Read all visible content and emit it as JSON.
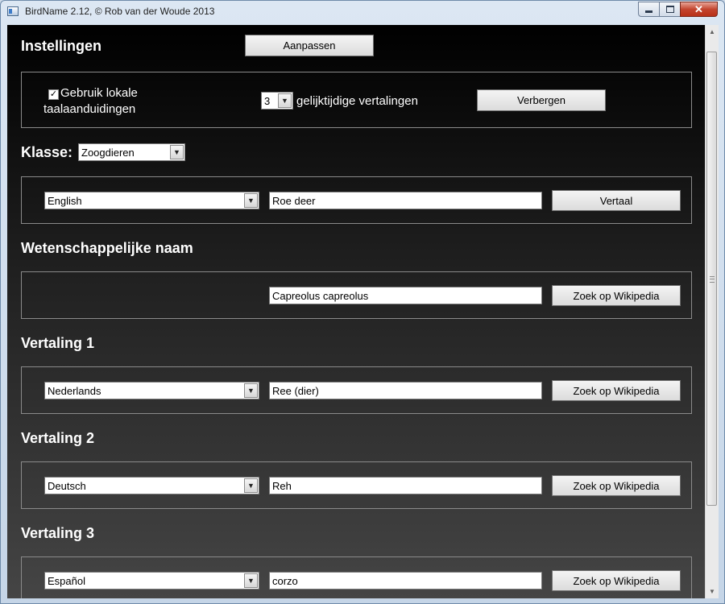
{
  "window": {
    "title": "BirdName 2.12, © Rob van der Woude 2013",
    "close_glyph": "✕"
  },
  "settings": {
    "heading": "Instellingen",
    "customize_label": "Aanpassen",
    "use_local_label_line1": "Gebruik lokale",
    "use_local_label_line2": "taalaanduidingen",
    "use_local_checked": true,
    "concurrent_value": "3",
    "concurrent_label": "gelijktijdige vertalingen",
    "hide_label": "Verbergen"
  },
  "klasse": {
    "label": "Klasse:",
    "value": "Zoogdieren"
  },
  "source": {
    "language": "English",
    "term": "Roe deer",
    "translate_label": "Vertaal"
  },
  "scientific": {
    "heading": "Wetenschappelijke naam",
    "value": "Capreolus capreolus",
    "wiki_label": "Zoek op Wikipedia"
  },
  "translations": [
    {
      "heading": "Vertaling 1",
      "language": "Nederlands",
      "value": "Ree (dier)",
      "wiki_label": "Zoek op Wikipedia"
    },
    {
      "heading": "Vertaling 2",
      "language": "Deutsch",
      "value": "Reh",
      "wiki_label": "Zoek op Wikipedia"
    },
    {
      "heading": "Vertaling 3",
      "language": "Español",
      "value": "corzo",
      "wiki_label": "Zoek op Wikipedia"
    }
  ]
}
